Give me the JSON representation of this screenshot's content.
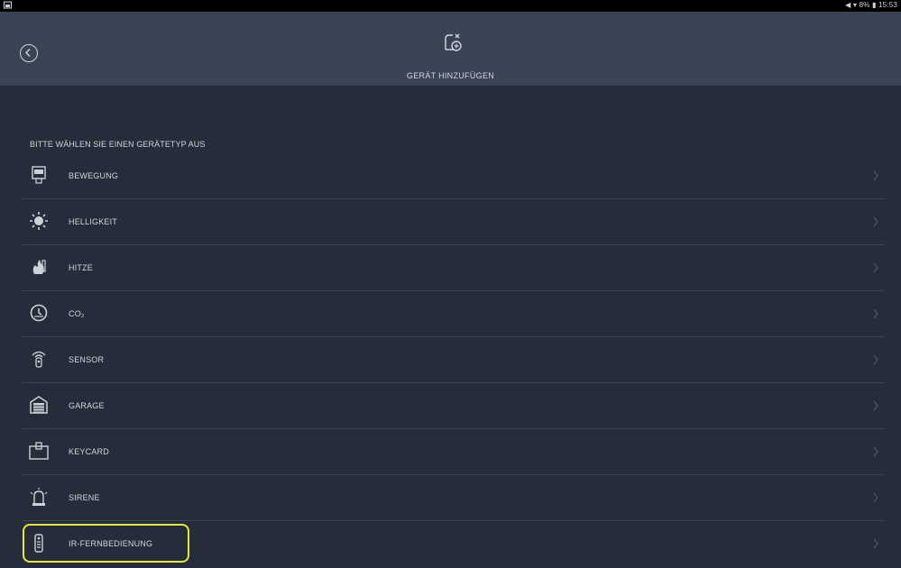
{
  "status_bar": {
    "right_text": "◀ ▾ 8% ▮ 15:53"
  },
  "header": {
    "title": "GERÄT HINZUFÜGEN",
    "back_icon": "back-circle-icon",
    "device_icon": "device-add-icon"
  },
  "main": {
    "section_label": "BITTE WÄHLEN SIE EINEN GERÄTETYP AUS",
    "items": [
      {
        "label": "BEWEGUNG",
        "icon": "motion-sensor-icon"
      },
      {
        "label": "HELLIGKEIT",
        "icon": "brightness-icon"
      },
      {
        "label": "HITZE",
        "icon": "heat-icon"
      },
      {
        "label": "CO₂",
        "icon": "co2-icon"
      },
      {
        "label": "SENSOR",
        "icon": "sensor-icon"
      },
      {
        "label": "GARAGE",
        "icon": "garage-icon"
      },
      {
        "label": "KEYCARD",
        "icon": "keycard-icon"
      },
      {
        "label": "SIRENE",
        "icon": "siren-icon"
      },
      {
        "label": "IR-FERNBEDIENUNG",
        "icon": "ir-remote-icon",
        "highlighted": true
      }
    ]
  },
  "colors": {
    "background": "#262d3a",
    "header": "#3a4353",
    "highlight": "#e5ea3a"
  }
}
